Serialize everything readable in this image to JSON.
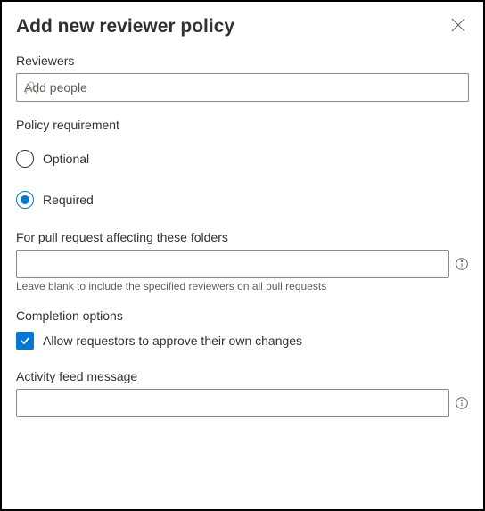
{
  "header": {
    "title": "Add new reviewer policy"
  },
  "reviewers": {
    "label": "Reviewers",
    "placeholder": "Add people",
    "value": ""
  },
  "policy_requirement": {
    "label": "Policy requirement",
    "options": {
      "optional": "Optional",
      "required": "Required"
    },
    "selected": "required"
  },
  "paths": {
    "label": "For pull request affecting these folders",
    "value": "",
    "hint": "Leave blank to include the specified reviewers on all pull requests"
  },
  "completion": {
    "label": "Completion options",
    "allow_self_approve": {
      "checked": true,
      "label": "Allow requestors to approve their own changes"
    }
  },
  "activity": {
    "label": "Activity feed message",
    "value": ""
  }
}
